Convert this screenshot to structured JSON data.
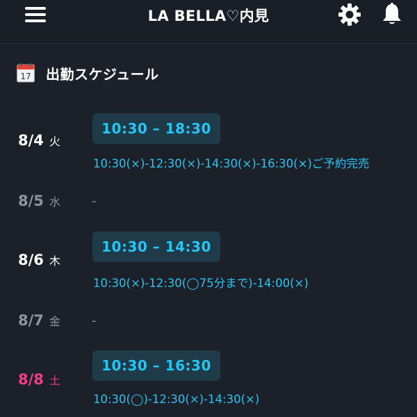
{
  "header": {
    "title": "LA BELLA♡内見",
    "menu_icon": "hamburger-menu-icon",
    "settings_icon": "gear-icon",
    "notifications_icon": "bell-icon"
  },
  "section": {
    "icon": "calendar-icon",
    "calendar_number": "17",
    "title": "出勤スケジュール"
  },
  "schedule": [
    {
      "date": "8/4",
      "dow": "火",
      "hours": "10:30 – 18:30",
      "slots": "10:30(×)-12:30(×)-14:30(×)-16:30(×)ご予約完売"
    },
    {
      "date": "8/5",
      "dow": "水",
      "off_text": "-"
    },
    {
      "date": "8/6",
      "dow": "木",
      "hours": "10:30 – 14:30",
      "slots": "10:30(×)-12:30(◯75分まで)-14:00(×)"
    },
    {
      "date": "8/7",
      "dow": "金",
      "off_text": "-"
    },
    {
      "date": "8/8",
      "dow": "土",
      "hours": "10:30 – 16:30",
      "slots": "10:30(◯)-12:30(×)-14:30(×)"
    }
  ],
  "colors": {
    "background": "#1c2029",
    "accent_cyan": "#23c6f4",
    "pill_background": "#1f3a49",
    "saturday": "#ef3f86",
    "off_day": "#8e939c"
  }
}
